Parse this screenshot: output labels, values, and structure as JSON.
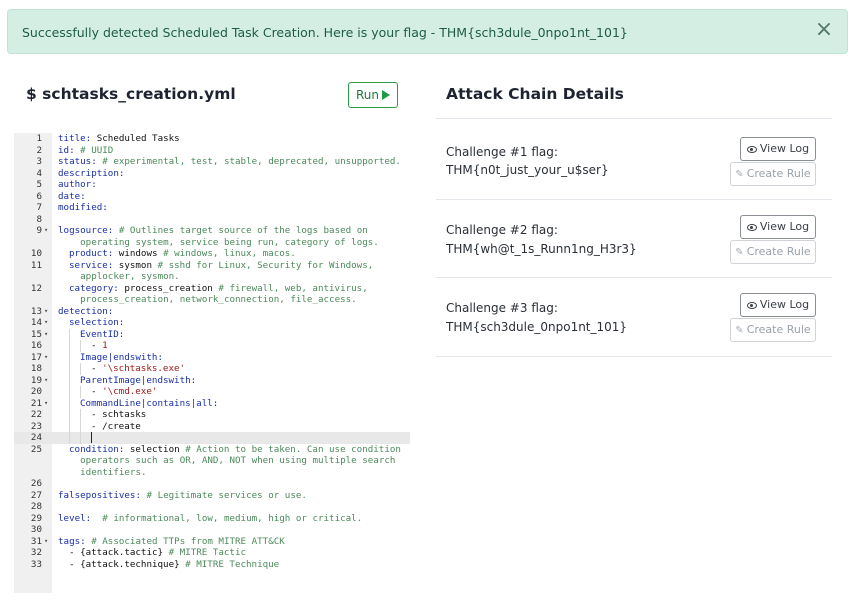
{
  "alert": {
    "message": "Successfully detected Scheduled Task Creation. Here is your flag - THM{sch3dule_0npo1nt_101}",
    "close_glyph": "×"
  },
  "editor_panel": {
    "file_title": "$ schtasks_creation.yml",
    "run_label": "Run"
  },
  "code_lines": [
    {
      "n": "1",
      "fold": "",
      "indent": 0,
      "parts": [
        [
          "key",
          "title:"
        ],
        [
          "plain",
          " Scheduled Tasks"
        ]
      ]
    },
    {
      "n": "2",
      "fold": "",
      "indent": 0,
      "parts": [
        [
          "key",
          "id:"
        ],
        [
          "cmt",
          " # UUID"
        ]
      ]
    },
    {
      "n": "3",
      "fold": "",
      "indent": 0,
      "parts": [
        [
          "key",
          "status:"
        ],
        [
          "cmt",
          " # experimental, test, stable, deprecated, unsupported."
        ]
      ]
    },
    {
      "n": "4",
      "fold": "",
      "indent": 0,
      "parts": [
        [
          "key",
          "description:"
        ]
      ]
    },
    {
      "n": "5",
      "fold": "",
      "indent": 0,
      "parts": [
        [
          "key",
          "author:"
        ]
      ]
    },
    {
      "n": "6",
      "fold": "",
      "indent": 0,
      "parts": [
        [
          "key",
          "date:"
        ]
      ]
    },
    {
      "n": "7",
      "fold": "",
      "indent": 0,
      "parts": [
        [
          "key",
          "modified:"
        ]
      ]
    },
    {
      "n": "8",
      "fold": "",
      "indent": 0,
      "parts": []
    },
    {
      "n": "9",
      "fold": "▾",
      "indent": 0,
      "parts": [
        [
          "key",
          "logsource:"
        ],
        [
          "cmt",
          " # Outlines target source of the logs based on\n    operating system, service being run, category of logs."
        ]
      ]
    },
    {
      "n": "10",
      "fold": "",
      "indent": 1,
      "parts": [
        [
          "key",
          "product:"
        ],
        [
          "plain",
          " windows"
        ],
        [
          "cmt",
          " # windows, linux, macos."
        ]
      ]
    },
    {
      "n": "11",
      "fold": "",
      "indent": 1,
      "parts": [
        [
          "key",
          "service:"
        ],
        [
          "plain",
          " sysmon"
        ],
        [
          "cmt",
          " # sshd for Linux, Security for Windows,\n    applocker, sysmon."
        ]
      ]
    },
    {
      "n": "12",
      "fold": "",
      "indent": 1,
      "parts": [
        [
          "key",
          "category:"
        ],
        [
          "plain",
          " process_creation"
        ],
        [
          "cmt",
          " # firewall, web, antivirus,\n    process_creation, network_connection, file_access."
        ]
      ]
    },
    {
      "n": "13",
      "fold": "▾",
      "indent": 0,
      "parts": [
        [
          "key",
          "detection:"
        ]
      ]
    },
    {
      "n": "14",
      "fold": "▾",
      "indent": 1,
      "parts": [
        [
          "key",
          "selection:"
        ]
      ]
    },
    {
      "n": "15",
      "fold": "▾",
      "indent": 2,
      "parts": [
        [
          "key",
          "EventID:"
        ]
      ]
    },
    {
      "n": "16",
      "fold": "",
      "indent": 3,
      "parts": [
        [
          "plain",
          "- "
        ],
        [
          "str",
          "1"
        ]
      ]
    },
    {
      "n": "17",
      "fold": "▾",
      "indent": 2,
      "parts": [
        [
          "key",
          "Image|endswith:"
        ]
      ]
    },
    {
      "n": "18",
      "fold": "",
      "indent": 3,
      "parts": [
        [
          "plain",
          "- "
        ],
        [
          "str",
          "'\\schtasks.exe'"
        ]
      ]
    },
    {
      "n": "19",
      "fold": "▾",
      "indent": 2,
      "parts": [
        [
          "key",
          "ParentImage|endswith:"
        ]
      ]
    },
    {
      "n": "20",
      "fold": "",
      "indent": 3,
      "parts": [
        [
          "plain",
          "- "
        ],
        [
          "str",
          "'\\cmd.exe'"
        ]
      ]
    },
    {
      "n": "21",
      "fold": "▾",
      "indent": 2,
      "parts": [
        [
          "key",
          "CommandLine|contains|all:"
        ]
      ]
    },
    {
      "n": "22",
      "fold": "",
      "indent": 3,
      "parts": [
        [
          "plain",
          "- schtasks"
        ]
      ]
    },
    {
      "n": "23",
      "fold": "",
      "indent": 3,
      "parts": [
        [
          "plain",
          "- /create"
        ]
      ]
    },
    {
      "n": "24",
      "fold": "",
      "indent": 3,
      "active": true,
      "parts": []
    },
    {
      "n": "25",
      "fold": "",
      "indent": 1,
      "parts": [
        [
          "key",
          "condition:"
        ],
        [
          "plain",
          " selection"
        ],
        [
          "cmt",
          " # Action to be taken. Can use condition\n    operators such as OR, AND, NOT when using multiple search\n    identifiers."
        ]
      ]
    },
    {
      "n": "26",
      "fold": "",
      "indent": 0,
      "parts": []
    },
    {
      "n": "27",
      "fold": "",
      "indent": 0,
      "parts": [
        [
          "key",
          "falsepositives:"
        ],
        [
          "cmt",
          " # Legitimate services or use."
        ]
      ]
    },
    {
      "n": "28",
      "fold": "",
      "indent": 0,
      "parts": []
    },
    {
      "n": "29",
      "fold": "",
      "indent": 0,
      "parts": [
        [
          "key",
          "level:"
        ],
        [
          "cmt",
          "  # informational, low, medium, high or critical."
        ]
      ]
    },
    {
      "n": "30",
      "fold": "",
      "indent": 0,
      "parts": []
    },
    {
      "n": "31",
      "fold": "▾",
      "indent": 0,
      "parts": [
        [
          "key",
          "tags:"
        ],
        [
          "cmt",
          " # Associated TTPs from MITRE ATT&CK"
        ]
      ]
    },
    {
      "n": "32",
      "fold": "",
      "indent": 1,
      "parts": [
        [
          "plain",
          "- {attack.tactic}"
        ],
        [
          "cmt",
          " # MITRE Tactic"
        ]
      ]
    },
    {
      "n": "33",
      "fold": "",
      "indent": 1,
      "parts": [
        [
          "plain",
          "- {attack.technique}"
        ],
        [
          "cmt",
          " # MITRE Technique"
        ]
      ]
    }
  ],
  "attack_panel": {
    "title": "Attack Chain Details",
    "view_log_label": "View Log",
    "create_rule_label": "Create Rule",
    "challenges": [
      {
        "label": "Challenge #1 flag:",
        "flag": "THM{n0t_just_your_u$ser}"
      },
      {
        "label": "Challenge #2 flag:",
        "flag": "THM{wh@t_1s_Runn1ng_H3r3}"
      },
      {
        "label": "Challenge #3 flag:",
        "flag": "THM{sch3dule_0npo1nt_101}"
      }
    ]
  }
}
